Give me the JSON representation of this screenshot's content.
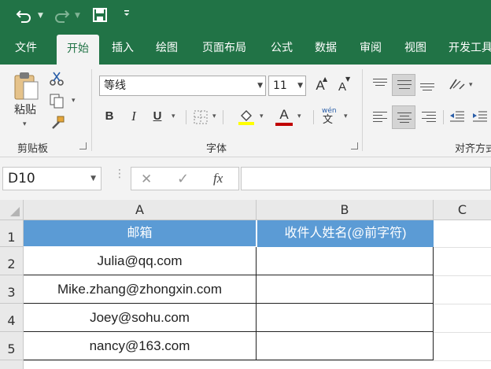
{
  "quick_access": {
    "undo_icon": "undo-icon",
    "redo_icon": "redo-icon",
    "save_icon": "save-icon",
    "customize_icon": "customize-qat-icon"
  },
  "tabs": [
    "文件",
    "开始",
    "插入",
    "绘图",
    "页面布局",
    "公式",
    "数据",
    "审阅",
    "视图",
    "开发工具"
  ],
  "ribbon": {
    "clipboard": {
      "paste_label": "粘贴",
      "group_label": "剪贴板"
    },
    "font": {
      "font_name": "等线",
      "font_size": "11",
      "bold": "B",
      "italic": "I",
      "underline": "U",
      "font_color_glyph": "A",
      "phonetic_glyph_top": "wén",
      "phonetic_glyph_bottom": "文",
      "grow_glyph": "A",
      "shrink_glyph": "A",
      "group_label": "字体",
      "fill_color": "#ffff00",
      "font_color": "#c00000"
    },
    "alignment": {
      "group_label": "对齐方式"
    }
  },
  "formula_bar": {
    "name_box": "D10",
    "cancel_glyph": "✕",
    "enter_glyph": "✓",
    "fx_label": "fx",
    "formula": ""
  },
  "sheet": {
    "columns": [
      "A",
      "B",
      "C"
    ],
    "rows": [
      "1",
      "2",
      "3",
      "4",
      "5"
    ],
    "header_fill": "#5b9bd5",
    "cells": {
      "A1": "邮箱",
      "B1": "收件人姓名(@前字符)",
      "A2": "Julia@qq.com",
      "A3": "Mike.zhang@zhongxin.com",
      "A4": "Joey@sohu.com",
      "A5": "nancy@163.com",
      "B2": "",
      "B3": "",
      "B4": "",
      "B5": ""
    }
  }
}
